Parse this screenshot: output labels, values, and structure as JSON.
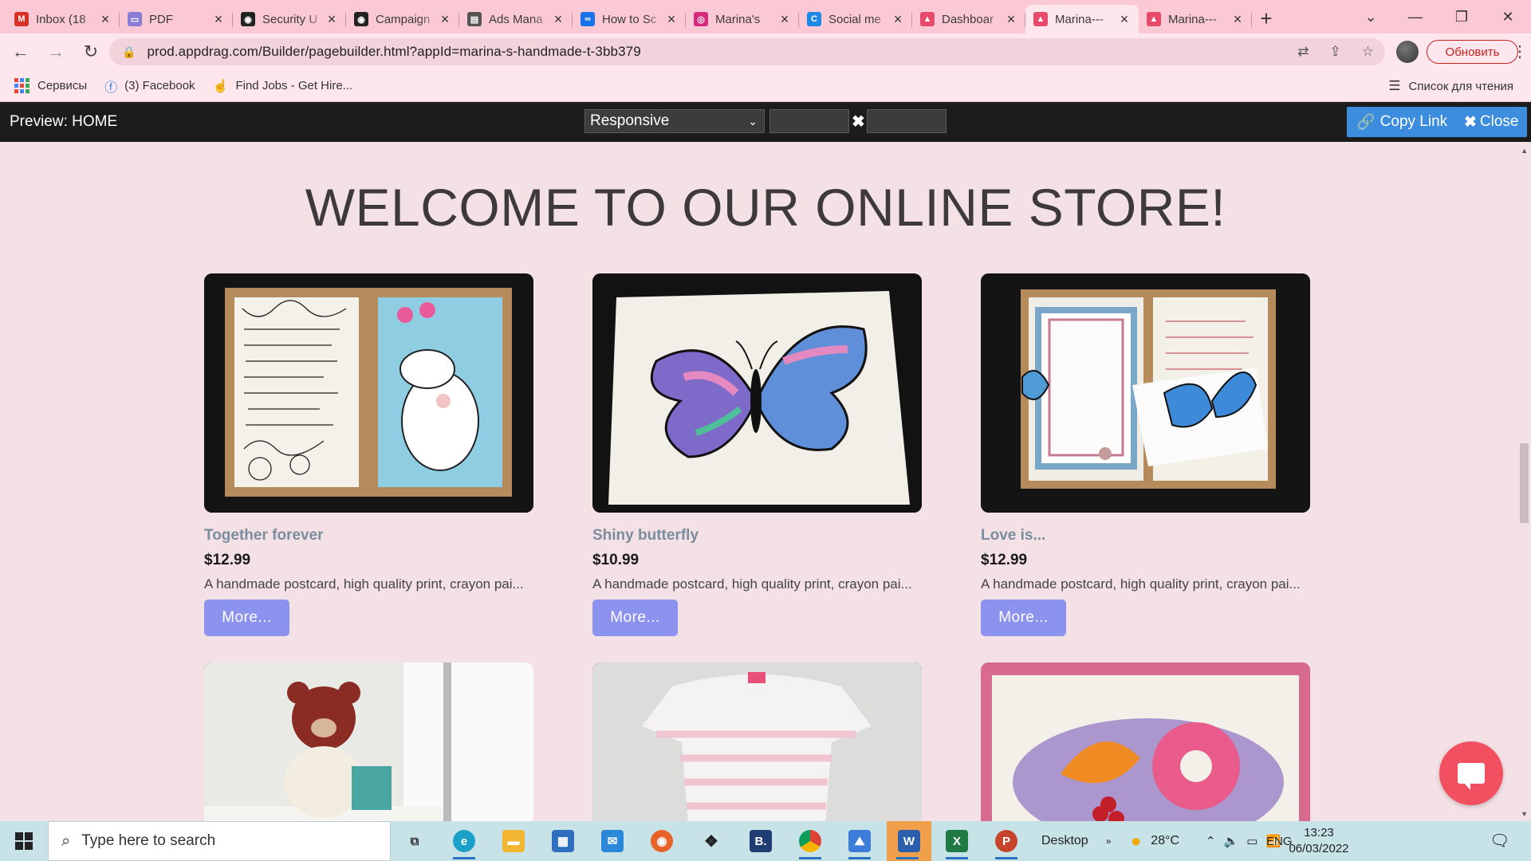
{
  "browser": {
    "tabs": [
      {
        "title": "Inbox (18",
        "favicon": "gmail-icon",
        "color": "#d93025",
        "glyph": "M"
      },
      {
        "title": "PDF",
        "favicon": "pdf-icon",
        "color": "#8a7dd6",
        "glyph": "▭"
      },
      {
        "title": "Security U",
        "favicon": "mailchimp-icon",
        "color": "#222",
        "glyph": "◉"
      },
      {
        "title": "Campaign",
        "favicon": "mailchimp-icon",
        "color": "#222",
        "glyph": "◉"
      },
      {
        "title": "Ads Mana",
        "favicon": "ads-manager-icon",
        "color": "#555",
        "glyph": "▤"
      },
      {
        "title": "How to Sc",
        "favicon": "meta-icon",
        "color": "#1a73e8",
        "glyph": "∞"
      },
      {
        "title": "Marina's",
        "favicon": "instagram-icon",
        "color": "#d6297a",
        "glyph": "◎"
      },
      {
        "title": "Social me",
        "favicon": "social-icon",
        "color": "#1e88e5",
        "glyph": "C"
      },
      {
        "title": "Dashboar",
        "favicon": "appdrag-icon",
        "color": "#e84a6a",
        "glyph": "▲"
      },
      {
        "title": "Marina---",
        "favicon": "appdrag-icon",
        "color": "#e84a6a",
        "glyph": "▲",
        "active": true
      },
      {
        "title": "Marina---",
        "favicon": "appdrag-icon",
        "color": "#e84a6a",
        "glyph": "▲"
      }
    ],
    "url": "prod.appdrag.com/Builder/pagebuilder.html?appId=marina-s-handmade-t-3bb379",
    "update_label": "Обновить",
    "bookmarks": [
      {
        "label": "Сервисы"
      },
      {
        "label": "(3) Facebook"
      },
      {
        "label": "Find Jobs - Get Hire..."
      }
    ],
    "reading_list": "Список для чтения"
  },
  "preview": {
    "title": "Preview: HOME",
    "device_mode": "Responsive",
    "width_value": "",
    "height_value": "",
    "copy_link_label": "Copy Link",
    "close_label": "Close",
    "accent": "#3c8dde"
  },
  "store": {
    "heading": "WELCOME TO OUR ONLINE STORE!",
    "more_label": "More...",
    "products": [
      {
        "name": "Together forever",
        "price": "$12.99",
        "description": "A handmade postcard, high quality print, crayon pai..."
      },
      {
        "name": "Shiny butterfly",
        "price": "$10.99",
        "description": "A handmade postcard, high quality print, crayon pai..."
      },
      {
        "name": "Love is...",
        "price": "$12.99",
        "description": "A handmade postcard, high quality print, crayon pai..."
      }
    ],
    "button_color": "#8b93ee",
    "chat_color": "#f25060"
  },
  "taskbar": {
    "search_placeholder": "Type here to search",
    "desktop_label": "Desktop",
    "temperature": "28°C",
    "language": "ENG",
    "time": "13:23",
    "date": "06/03/2022"
  }
}
